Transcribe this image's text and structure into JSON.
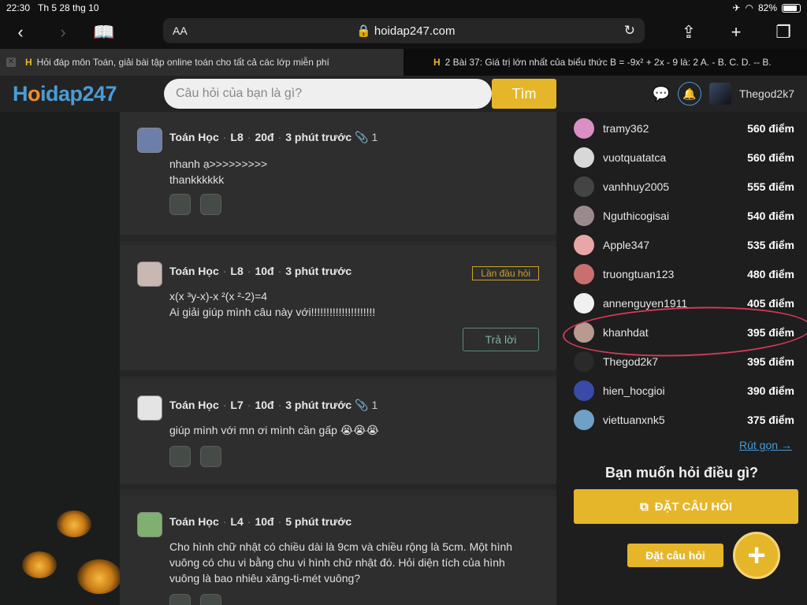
{
  "status": {
    "time": "22:30",
    "date": "Th 5 28 thg 10",
    "battery": "82%"
  },
  "browser": {
    "aa": "AA",
    "url": "hoidap247.com",
    "tabs": [
      {
        "title": "Hỏi đáp môn Toán, giải bài tập online toán cho tất cả các lớp miễn phí"
      },
      {
        "title": "2 Bài 37: Giá trị lớn nhất của biểu thức B = -9x² + 2x - 9 là: 2 A. - B. C. D. -- B."
      }
    ]
  },
  "header": {
    "logo_a": "H",
    "logo_o": "o",
    "logo_b": "idap247",
    "search_placeholder": "Câu hỏi của bạn là gì?",
    "search_button": "Tìm",
    "username": "Thegod2k7"
  },
  "feed": [
    {
      "subject": "Toán Học",
      "grade": "L8",
      "points": "20đ",
      "time": "3 phút trước",
      "attachments": "1",
      "lines": [
        "nhanh ạ>>>>>>>>>",
        "thankkkkkk"
      ]
    },
    {
      "subject": "Toán Học",
      "grade": "L8",
      "points": "10đ",
      "time": "3 phút trước",
      "badge": "Lần đầu hỏi",
      "lines": [
        "x(x ³y-x)-x ²(x ²-2)=4",
        "Ai giải giúp mình câu này với!!!!!!!!!!!!!!!!!!!!!"
      ],
      "reply": "Trả lời"
    },
    {
      "subject": "Toán Học",
      "grade": "L7",
      "points": "10đ",
      "time": "3 phút trước",
      "attachments": "1",
      "lines": [
        "giúp mình với mn ơi mình cần gấp 😭😭😭"
      ]
    },
    {
      "subject": "Toán Học",
      "grade": "L4",
      "points": "10đ",
      "time": "5 phút trước",
      "lines": [
        "Cho hình chữ nhật có chiều dài là 9cm và chiều rộng là 5cm. Một hình",
        "vuông có chu vi bằng chu vi hình chữ nhật đó. Hỏi diện tích của hình",
        "vuông là bao nhiêu xăng-ti-mét vuông?"
      ]
    }
  ],
  "ranking": [
    {
      "name": "tramy362",
      "points": "560 điểm"
    },
    {
      "name": "vuotquatatca",
      "points": "560 điểm"
    },
    {
      "name": "vanhhuy2005",
      "points": "555 điểm"
    },
    {
      "name": "Nguthicogisai",
      "points": "540 điểm"
    },
    {
      "name": "Apple347",
      "points": "535 điểm"
    },
    {
      "name": "truongtuan123",
      "points": "480 điểm"
    },
    {
      "name": "annenguyen1911",
      "points": "405 điểm"
    },
    {
      "name": "khanhdat",
      "points": "395 điểm"
    },
    {
      "name": "Thegod2k7",
      "points": "395 điểm"
    },
    {
      "name": "hien_hocgioi",
      "points": "390 điểm"
    },
    {
      "name": "viettuanxnk5",
      "points": "375 điểm"
    }
  ],
  "sidebar": {
    "collapse": "Rút gọn",
    "ask_title": "Bạn muốn hỏi điều gì?",
    "ask_button": "ĐẶT CÂU HỎI",
    "float_label": "Đặt câu hỏi",
    "float_plus": "+"
  }
}
